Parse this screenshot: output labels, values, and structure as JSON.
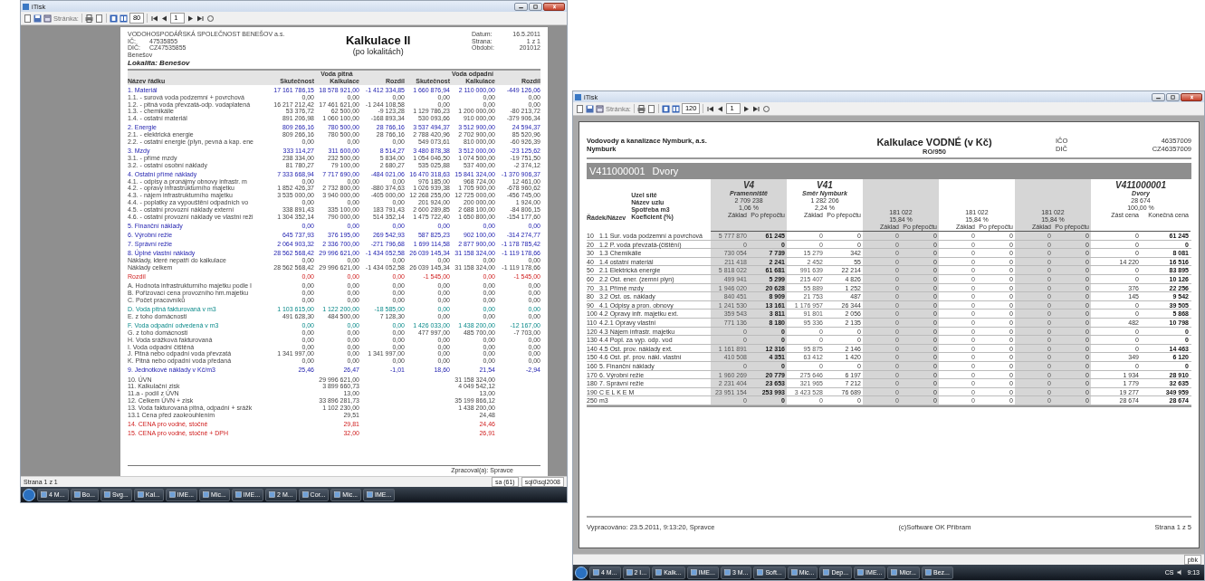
{
  "left_window": {
    "title": "iTisk",
    "toolbar": {
      "page_label": "Stránka:",
      "zoom": "80",
      "page": "1"
    },
    "report": {
      "company": "VODOHOSPODÁŘSKÁ SPOLEČNOST BENEŠOV a.s.",
      "ids": [
        {
          "label": "IČ:",
          "value": "47535855"
        },
        {
          "label": "DIČ:",
          "value": "CZ47535855"
        }
      ],
      "city": "Benešov",
      "title": "Kalkulace II",
      "subtitle": "(po lokalitách)",
      "meta": [
        {
          "label": "Datum:",
          "value": "16.5.2011"
        },
        {
          "label": "Strana:",
          "value": "1 z 1"
        },
        {
          "label": "Období:",
          "value": "201012"
        }
      ],
      "locality": "Lokalita: Benešov",
      "label_header": "Název řádku",
      "column_groups": [
        {
          "title": "Voda pitná",
          "columns": [
            "Skutečnost",
            "Kalkulace",
            "Rozdíl"
          ]
        },
        {
          "title": "Voda odpadní",
          "columns": [
            "Skutečnost",
            "Kalkulace",
            "Rozdíl"
          ]
        }
      ],
      "groups": [
        [
          {
            "kind": "section",
            "label": "1. Materiál",
            "values": [
              "17 161 786,15",
              "18 578 921,00",
              "-1 412 334,85",
              "1 660 876,94",
              "2 110 000,00",
              "-449 126,06"
            ]
          },
          {
            "kind": "item",
            "label": "1.1. - surová voda podzemní + povrchová",
            "values": [
              "0,00",
              "0,00",
              "0,00",
              "0,00",
              "0,00",
              "0,00"
            ]
          },
          {
            "kind": "item",
            "label": "1.2. - pitná voda převzatá-odp. vodaplatená",
            "values": [
              "16 217 212,42",
              "17 461 621,00",
              "-1 244 108,58",
              "0,00",
              "0,00",
              "0,00"
            ]
          },
          {
            "kind": "item",
            "label": "1.3. - chemikálie",
            "values": [
              "53 376,72",
              "62 500,00",
              "-9 123,28",
              "1 129 786,23",
              "1 200 000,00",
              "-80 213,72"
            ]
          },
          {
            "kind": "item",
            "label": "1.4. - ostatní materiál",
            "values": [
              "891 206,98",
              "1 060 100,00",
              "-168 893,34",
              "530 093,66",
              "910 000,00",
              "-379 906,34"
            ]
          }
        ],
        [
          {
            "kind": "section",
            "label": "2. Energie",
            "values": [
              "809 266,16",
              "780 500,00",
              "28 766,16",
              "3 537 494,37",
              "3 512 900,00",
              "24 594,37"
            ]
          },
          {
            "kind": "item",
            "label": "2.1. - elektrická energie",
            "values": [
              "809 266,16",
              "780 500,00",
              "28 766,16",
              "2 788 420,96",
              "2 702 900,00",
              "85 520,96"
            ]
          },
          {
            "kind": "item",
            "label": "2.2. - ostatní energie (plyn, pevná a kap. ene",
            "values": [
              "0,00",
              "0,00",
              "0,00",
              "549 073,61",
              "810 000,00",
              "-60 926,39"
            ]
          }
        ],
        [
          {
            "kind": "section",
            "label": "3. Mzdy",
            "values": [
              "333 114,27",
              "311 600,00",
              "8 514,27",
              "3 480 878,38",
              "3 512 000,00",
              "-23 125,62"
            ]
          },
          {
            "kind": "item",
            "label": "3.1. - přímé mzdy",
            "values": [
              "238 334,00",
              "232 500,00",
              "5 834,00",
              "1 054 046,50",
              "1 074 500,00",
              "-19 751,50"
            ]
          },
          {
            "kind": "item",
            "label": "3.2. - ostatní osobní náklady",
            "values": [
              "81 780,27",
              "79 100,00",
              "2 680,27",
              "535 025,88",
              "537 400,00",
              "-2 374,12"
            ]
          }
        ],
        [
          {
            "kind": "section",
            "label": "4. Ostatní přímé náklady",
            "values": [
              "7 333 668,94",
              "7 717 690,00",
              "-484 021,06",
              "16 470 318,63",
              "15 841 324,00",
              "-1 370 906,37"
            ]
          },
          {
            "kind": "item",
            "label": "4.1. - odpisy a pronájmy obnovy infrastr. m",
            "values": [
              "0,00",
              "0,00",
              "0,00",
              "976 185,00",
              "968 724,00",
              "12 461,00"
            ]
          },
          {
            "kind": "item",
            "label": "4.2. - opravy infrastrukturního majetku",
            "values": [
              "1 852 426,37",
              "2 732 800,00",
              "-880 374,63",
              "1 026 939,38",
              "1 705 900,00",
              "-678 960,62"
            ]
          },
          {
            "kind": "item",
            "label": "4.3. - nájem infrastrukturního majetku",
            "values": [
              "3 535 000,00",
              "3 940 000,00",
              "-405 000,00",
              "12 268 255,00",
              "12 725 000,00",
              "-456 745,00"
            ]
          },
          {
            "kind": "item",
            "label": "4.4. - poplatky za vypouštění odpadních vo",
            "values": [
              "0,00",
              "0,00",
              "0,00",
              "201 924,00",
              "200 000,00",
              "1 924,00"
            ]
          },
          {
            "kind": "item",
            "label": "4.5. - ostatní provozní náklady externí",
            "values": [
              "338 891,43",
              "335 100,00",
              "183 791,43",
              "2 600 289,85",
              "2 688 100,00",
              "-84 806,15"
            ]
          },
          {
            "kind": "item",
            "label": "4.6. - ostatní provozní náklady ve vlastní reži",
            "values": [
              "1 304 352,14",
              "790 000,00",
              "514 352,14",
              "1 475 722,40",
              "1 650 800,00",
              "-154 177,60"
            ]
          }
        ],
        [
          {
            "kind": "section",
            "label": "5. Finanční náklady",
            "values": [
              "0,00",
              "0,00",
              "0,00",
              "0,00",
              "0,00",
              "0,00"
            ]
          }
        ],
        [
          {
            "kind": "section",
            "label": "6. Výrobní režie",
            "values": [
              "645 737,93",
              "376 195,00",
              "269 542,93",
              "587 825,23",
              "902 100,00",
              "-314 274,77"
            ]
          }
        ],
        [
          {
            "kind": "section",
            "label": "7. Správní režie",
            "values": [
              "2 064 903,32",
              "2 336 700,00",
              "-271 796,68",
              "1 699 114,58",
              "2 877 900,00",
              "-1 178 785,42"
            ]
          }
        ],
        [
          {
            "kind": "section",
            "label": "8. Úplné vlastní náklady",
            "values": [
              "28 562 568,42",
              "29 996 621,00",
              "-1 434 052,58",
              "26 039 145,34",
              "31 158 324,00",
              "-1 119 178,66"
            ]
          },
          {
            "kind": "note",
            "label": "Náklady, které nepatří do kalkulace",
            "values": [
              "0,00",
              "0,00",
              "0,00",
              "0,00",
              "0,00",
              "0,00"
            ]
          },
          {
            "kind": "note",
            "label": "Náklady celkem",
            "values": [
              "28 562 568,42",
              "29 996 621,00",
              "-1 434 052,58",
              "26 039 145,34",
              "31 158 324,00",
              "-1 119 178,66"
            ]
          }
        ],
        [
          {
            "kind": "difference",
            "label": "Rozdíl",
            "values": [
              "0,00",
              "0,00",
              "0,00",
              "-1 545,00",
              "0,00",
              "-1 545,00"
            ]
          }
        ],
        [
          {
            "kind": "item",
            "label": "A. Hodnota infrastrukturního majetku podle I",
            "values": [
              "0,00",
              "0,00",
              "0,00",
              "0,00",
              "0,00",
              "0,00"
            ]
          },
          {
            "kind": "item",
            "label": "B. Pořizovací cena provozního hm.majetku",
            "values": [
              "0,00",
              "0,00",
              "0,00",
              "0,00",
              "0,00",
              "0,00"
            ]
          },
          {
            "kind": "item",
            "label": "C. Počet pracovníků",
            "values": [
              "0,00",
              "0,00",
              "0,00",
              "0,00",
              "0,00",
              "0,00"
            ]
          }
        ],
        [
          {
            "kind": "volume",
            "label": "D. Voda pitná fakturovaná v m3",
            "values": [
              "1 103 615,00",
              "1 122 200,00",
              "-18 585,00",
              "0,00",
              "0,00",
              "0,00"
            ]
          },
          {
            "kind": "item",
            "label": "E. z toho domácnosti",
            "values": [
              "491 628,30",
              "484 500,00",
              "7 128,30",
              "0,00",
              "0,00",
              "0,00"
            ]
          }
        ],
        [
          {
            "kind": "volume",
            "label": "F. Voda odpadní odvedená v m3",
            "values": [
              "0,00",
              "0,00",
              "0,00",
              "1 426 033,00",
              "1 438 200,00",
              "-12 167,00"
            ]
          },
          {
            "kind": "item",
            "label": "G. z toho domácnosti",
            "values": [
              "0,00",
              "0,00",
              "0,00",
              "477 997,00",
              "485 700,00",
              "-7 703,00"
            ]
          },
          {
            "kind": "item",
            "label": "H. Voda srážková fakturovaná",
            "values": [
              "0,00",
              "0,00",
              "0,00",
              "0,00",
              "0,00",
              "0,00"
            ]
          },
          {
            "kind": "item",
            "label": "I. Voda odpadní čištěná",
            "values": [
              "0,00",
              "0,00",
              "0,00",
              "0,00",
              "0,00",
              "0,00"
            ]
          },
          {
            "kind": "item",
            "label": "J. Pitná nebo odpadní voda převzatá",
            "values": [
              "1 341 997,00",
              "0,00",
              "1 341 997,00",
              "0,00",
              "0,00",
              "0,00"
            ]
          },
          {
            "kind": "item",
            "label": "K. Pitná nebo odpadní voda předaná",
            "values": [
              "0,00",
              "0,00",
              "0,00",
              "0,00",
              "0,00",
              "0,00"
            ]
          }
        ],
        [
          {
            "kind": "unit_cost",
            "label": "9. Jednotkové náklady v Kč/m3",
            "values": [
              "25,46",
              "26,47",
              "-1,01",
              "18,60",
              "21,54",
              "-2,94"
            ]
          }
        ],
        [
          {
            "kind": "summary",
            "label": "10. ÚVN",
            "pitna": "29 996 621,00",
            "odpadni": "31 158 324,00"
          },
          {
            "kind": "summary",
            "label": "11. Kalkulační zisk",
            "pitna": "3 899 660,73",
            "odpadni": "4 049 542,12"
          },
          {
            "kind": "summary",
            "label": "11.a - podíl z ÚVN",
            "pitna": "13,00",
            "odpadni": "13,00"
          },
          {
            "kind": "summary",
            "label": "12. Celkem ÚVN + zisk",
            "pitna": "33 896 281,73",
            "odpadni": "35 199 866,12"
          },
          {
            "kind": "summary",
            "label": "13. Voda fakturovaná pitná, odpadní + srážk",
            "pitna": "1 102 230,00",
            "odpadni": "1 438 200,00"
          },
          {
            "kind": "summary",
            "label": "13.1 Cena před zaokrouhlením",
            "pitna": "29,51",
            "odpadni": "24,48"
          }
        ],
        [
          {
            "kind": "price",
            "label": "14. CENA pro vodné, stočné",
            "pitna": "29,81",
            "odpadni": "24,46"
          }
        ],
        [
          {
            "kind": "price",
            "label": "15. CENA pro vodné, stočné + DPH",
            "pitna": "32,00",
            "odpadni": "26,91"
          }
        ]
      ],
      "footer": "Zpracoval(a): Spravce"
    },
    "status_bar": {
      "page": "Strana 1 z 1",
      "fields": [
        "sa (61)",
        "sql0\\sql2008"
      ]
    },
    "taskbar": {
      "items": [
        "4 M...",
        "Bo...",
        "Svg...",
        "Kal...",
        "IME...",
        "Mic...",
        "IME...",
        "2 M...",
        "Cor...",
        "Mic...",
        "IME..."
      ]
    }
  },
  "right_window": {
    "title": "iTisk",
    "toolbar": {
      "page_label": "Stránka:",
      "zoom": "120",
      "page": "1"
    },
    "report": {
      "company": "Vodovody a kanalizace Nymburk, a.s.",
      "city": "Nymburk",
      "title": "Kalkulace VODNÉ (v Kč)",
      "subtitle": "RO/950",
      "ids": [
        {
          "label": "IČO",
          "value": "46357009"
        },
        {
          "label": "DIČ",
          "value": "CZ46357009"
        }
      ],
      "band": {
        "code": "V411000001",
        "name": "Dvory"
      },
      "row_header": "Řádek/Název",
      "node_labels": [
        "Uzel sítě",
        "Název uzlu",
        "Spotřeba m3",
        "Koeficient (%)"
      ],
      "groups": [
        {
          "node": "V4",
          "name": "Pramenniště",
          "consumption": "2 709 238",
          "coefficient": "1,06 %",
          "subheaders": [
            "Základ",
            "Po přepočtu"
          ]
        },
        {
          "node": "V41",
          "name": "Směr Nymburk",
          "consumption": "1 282 206",
          "coefficient": "2,24 %",
          "subheaders": [
            "Základ",
            "Po přepočtu"
          ]
        },
        {
          "consumption": "181 022",
          "coefficient": "15,84 %",
          "subheaders": [
            "Základ",
            "Po přepočtu"
          ]
        },
        {
          "consumption": "181 022",
          "coefficient": "15,84 %",
          "subheaders": [
            "Základ",
            "Po přepočtu"
          ]
        },
        {
          "consumption": "181 022",
          "coefficient": "15,84 %",
          "subheaders": [
            "Základ",
            "Po přepočtu"
          ]
        },
        {
          "node": "V411000001",
          "name": "Dvory",
          "consumption": "28 674",
          "coefficient": "100,00 %",
          "subheaders": [
            "Zást cena",
            "Konečná cena"
          ]
        }
      ],
      "rows": [
        {
          "code": "10",
          "name": "1.1 Sur. voda podzemní a povrchová",
          "values": [
            "5 777 870",
            "61 245",
            "0",
            "0",
            "0",
            "0",
            "0",
            "0",
            "0",
            "0",
            "0",
            "61 245"
          ]
        },
        {
          "code": "20",
          "name": "1.2 P. voda převzatá-(čištění)",
          "values": [
            "0",
            "0",
            "0",
            "0",
            "0",
            "0",
            "0",
            "0",
            "0",
            "0",
            "0",
            "0"
          ]
        },
        {
          "code": "30",
          "name": "1.3 Chemikálie",
          "values": [
            "730 054",
            "7 739",
            "15 279",
            "342",
            "0",
            "0",
            "0",
            "0",
            "0",
            "0",
            "0",
            "8 081"
          ]
        },
        {
          "code": "40",
          "name": "1.4 ostatní materiál",
          "values": [
            "211 418",
            "2 241",
            "2 452",
            "55",
            "0",
            "0",
            "0",
            "0",
            "0",
            "0",
            "14 220",
            "16 516"
          ]
        },
        {
          "code": "50",
          "name": "2.1 Elektrická energie",
          "values": [
            "5 818 022",
            "61 681",
            "991 639",
            "22 214",
            "0",
            "0",
            "0",
            "0",
            "0",
            "0",
            "0",
            "83 895"
          ]
        },
        {
          "code": "60",
          "name": "2.2 Ost. ener. (zemní plyn)",
          "values": [
            "499 941",
            "5 299",
            "215 407",
            "4 826",
            "0",
            "0",
            "0",
            "0",
            "0",
            "0",
            "0",
            "10 126"
          ]
        },
        {
          "code": "70",
          "name": "3.1 Přímé mzdy",
          "values": [
            "1 946 020",
            "20 628",
            "55 889",
            "1 252",
            "0",
            "0",
            "0",
            "0",
            "0",
            "0",
            "376",
            "22 256"
          ]
        },
        {
          "code": "80",
          "name": "3.2 Ost. os. náklady",
          "values": [
            "840 451",
            "8 909",
            "21 753",
            "487",
            "0",
            "0",
            "0",
            "0",
            "0",
            "0",
            "145",
            "9 542"
          ]
        },
        {
          "code": "90",
          "name": "4.1 Odpisy a pron. obnovy",
          "values": [
            "1 241 530",
            "13 161",
            "1 176 957",
            "26 344",
            "0",
            "0",
            "0",
            "0",
            "0",
            "0",
            "0",
            "39 505"
          ]
        },
        {
          "code": "100",
          "name": "4.2 Opravy infr. majetku ext.",
          "values": [
            "359 543",
            "3 811",
            "91 801",
            "2 056",
            "0",
            "0",
            "0",
            "0",
            "0",
            "0",
            "0",
            "5 868"
          ]
        },
        {
          "code": "110",
          "name": "4.2.1 Opravy vlastní",
          "values": [
            "771 136",
            "8 180",
            "95 336",
            "2 135",
            "0",
            "0",
            "0",
            "0",
            "0",
            "0",
            "482",
            "10 798"
          ]
        },
        {
          "code": "120",
          "name": "4.3 Nájem infrastr. majetku",
          "values": [
            "0",
            "0",
            "0",
            "0",
            "0",
            "0",
            "0",
            "0",
            "0",
            "0",
            "0",
            "0"
          ]
        },
        {
          "code": "130",
          "name": "4.4 Popl. za vyp. odp. vod",
          "values": [
            "0",
            "0",
            "0",
            "0",
            "0",
            "0",
            "0",
            "0",
            "0",
            "0",
            "0",
            "0"
          ]
        },
        {
          "code": "140",
          "name": "4.5 Ost. prov. náklady ext.",
          "values": [
            "1 161 891",
            "12 316",
            "95 875",
            "2 146",
            "0",
            "0",
            "0",
            "0",
            "0",
            "0",
            "0",
            "14 463"
          ]
        },
        {
          "code": "150",
          "name": "4.6 Ost. př. prov. nákl. vlastní",
          "values": [
            "410 508",
            "4 351",
            "63 412",
            "1 420",
            "0",
            "0",
            "0",
            "0",
            "0",
            "0",
            "349",
            "6 120"
          ]
        },
        {
          "code": "160",
          "name": "5. Finanční náklady",
          "values": [
            "0",
            "0",
            "0",
            "0",
            "0",
            "0",
            "0",
            "0",
            "0",
            "0",
            "0",
            "0"
          ]
        },
        {
          "code": "170",
          "name": "6. Výrobní režie",
          "values": [
            "1 960 269",
            "20 779",
            "275 646",
            "6 197",
            "0",
            "0",
            "0",
            "0",
            "0",
            "0",
            "1 934",
            "28 910"
          ]
        },
        {
          "code": "180",
          "name": "7. Správní režie",
          "values": [
            "2 231 404",
            "23 653",
            "321 965",
            "7 212",
            "0",
            "0",
            "0",
            "0",
            "0",
            "0",
            "1 779",
            "32 635"
          ]
        },
        {
          "code": "190",
          "name": "C E L K E M",
          "values": [
            "23 951 154",
            "253 993",
            "3 423 528",
            "76 689",
            "0",
            "0",
            "0",
            "0",
            "0",
            "0",
            "19 277",
            "349 959"
          ]
        },
        {
          "code": "250",
          "name": "m3",
          "values": [
            "0",
            "0",
            "0",
            "0",
            "0",
            "0",
            "0",
            "0",
            "0",
            "0",
            "28 674",
            "28 674"
          ]
        }
      ],
      "footer": {
        "processed": "Vypracováno: 23.5.2011, 9:13:20, Spravce",
        "copyright": "(c)Software OK Příbram",
        "page": "Strana 1 z 5"
      }
    },
    "status_bar": {
      "fields": [
        "pbk"
      ]
    },
    "taskbar": {
      "items": [
        "4 M...",
        "2 I...",
        "Kalk...",
        "IME...",
        "3 M...",
        "Soft...",
        "Mic...",
        "Dep...",
        "IME...",
        "Micr...",
        "Bez..."
      ],
      "language": "CS",
      "clock": "9:13"
    }
  }
}
